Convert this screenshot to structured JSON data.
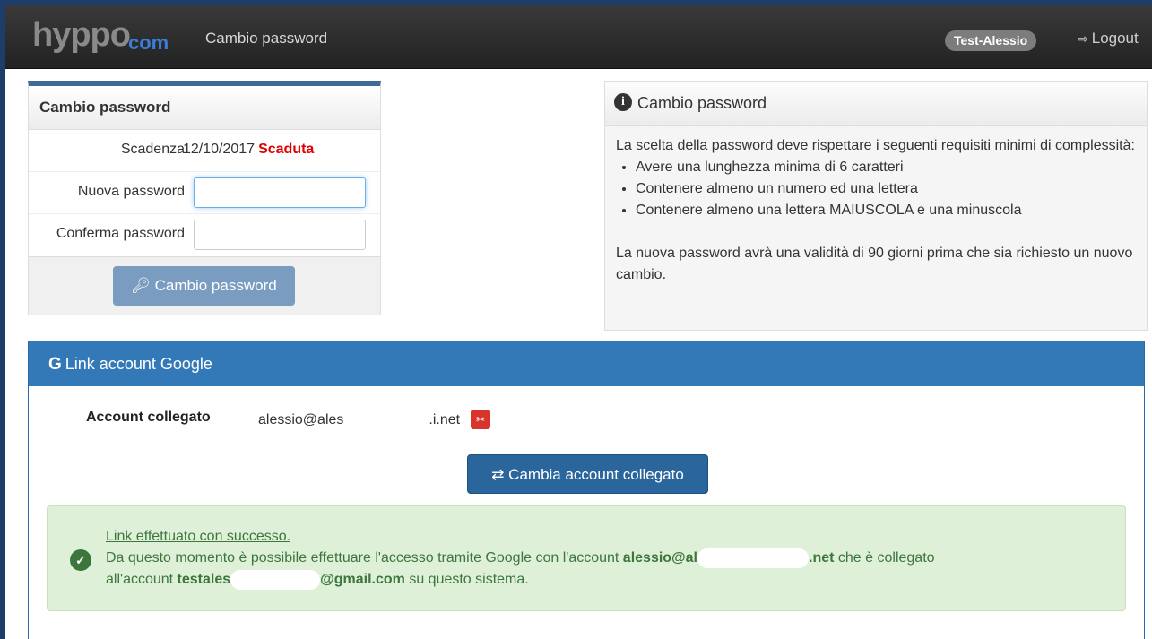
{
  "navbar": {
    "logo_main": "hyppo",
    "logo_sub": "com",
    "title": "Cambio password",
    "user": "Test-Alessio",
    "logout": "Logout"
  },
  "password_panel": {
    "header": "Cambio password",
    "scadenza_label": "Scadenza",
    "scadenza_date": "12/10/2017",
    "scadenza_status": "Scaduta",
    "new_label": "Nuova password",
    "new_value": "",
    "confirm_label": "Conferma password",
    "confirm_value": "",
    "button_label": "Cambio password"
  },
  "info_panel": {
    "header": "Cambio password",
    "intro": "La scelta della password deve rispettare i seguenti requisiti minimi di complessità:",
    "requirements": [
      "Avere una lunghezza minima di 6 caratteri",
      "Contenere almeno un numero ed una lettera",
      "Contenere almeno una lettera MAIUSCOLA e una minuscola"
    ],
    "validity": "La nuova password avrà una validità di 90 giorni prima che sia richiesto un nuovo cambio."
  },
  "google_panel": {
    "header": "Link account Google",
    "account_label": "Account collegato",
    "account_prefix": "alessio@ales",
    "account_suffix": ".i.net",
    "change_button": "Cambia account collegato",
    "alert": {
      "title": "Link effettuato con successo.",
      "line1_pre": "Da questo momento è possibile effettuare l'accesso tramite Google con l'account ",
      "line1_email_prefix": "alessio@al",
      "line1_email_suffix": ".net",
      "line1_post": " che è collegato",
      "line2_pre": "all'account ",
      "line2_user_prefix": "testales",
      "line2_user_suffix": "@gmail.com",
      "line2_post": " su questo sistema."
    }
  },
  "colors": {
    "navbar_bg": "#222222",
    "panel_accent": "#3f6a96",
    "google_header": "#3479b7",
    "primary_button": "#2a659c",
    "expired_red": "#e00000",
    "success_bg": "#dff0d8",
    "success_text": "#3c763d"
  }
}
